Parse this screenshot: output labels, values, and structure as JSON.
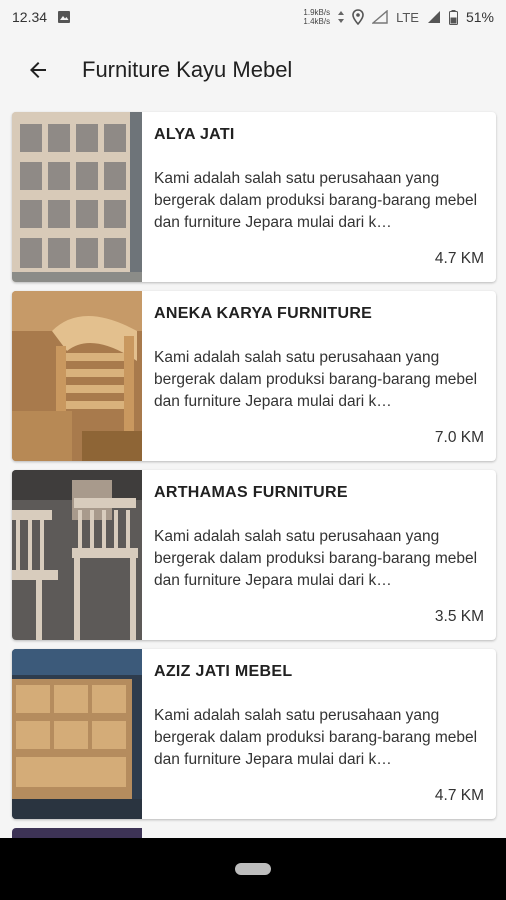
{
  "status_bar": {
    "time": "12.34",
    "speed_up": "1.9kB/s",
    "speed_down": "1.4kB/s",
    "network": "LTE",
    "battery": "51%"
  },
  "app_bar": {
    "back_icon": "arrow-left-icon",
    "title": "Furniture Kayu Mebel"
  },
  "items": [
    {
      "name": "ALYA JATI",
      "description": "Kami adalah salah satu perusahaan yang bergerak dalam produksi barang-barang mebel dan furniture Jepara mulai dari k…",
      "distance": "4.7 KM"
    },
    {
      "name": "ANEKA KARYA FURNITURE",
      "description": "Kami adalah salah satu perusahaan yang bergerak dalam produksi barang-barang mebel dan furniture Jepara mulai dari k…",
      "distance": "7.0 KM"
    },
    {
      "name": "ARTHAMAS FURNITURE",
      "description": "Kami adalah salah satu perusahaan yang bergerak dalam produksi barang-barang mebel dan furniture Jepara mulai dari k…",
      "distance": "3.5 KM"
    },
    {
      "name": "AZIZ JATI MEBEL",
      "description": "Kami adalah salah satu perusahaan yang bergerak dalam produksi barang-barang mebel dan furniture Jepara mulai dari k…",
      "distance": "4.7 KM"
    }
  ]
}
